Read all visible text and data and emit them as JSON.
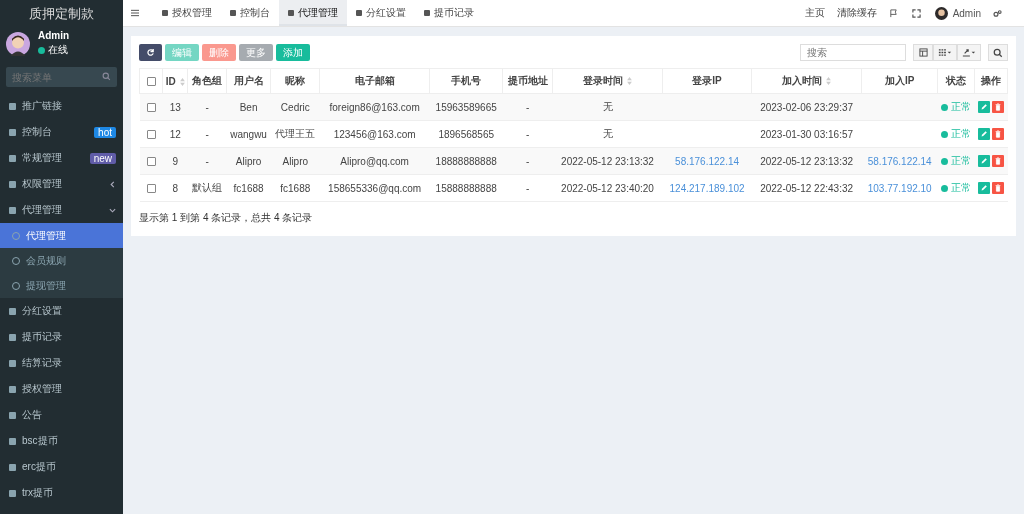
{
  "sidebar": {
    "brand": "质押定制款",
    "user": {
      "name": "Admin",
      "status": "在线"
    },
    "search": {
      "placeholder": "搜索菜单"
    },
    "items": [
      {
        "label": "推广链接",
        "selected": false
      },
      {
        "label": "控制台",
        "selected": false,
        "badge": "hot",
        "color": "#1e88e5"
      },
      {
        "label": "常规管理",
        "selected": false,
        "badge": "new",
        "color": "#605ca8"
      },
      {
        "label": "权限管理",
        "selected": false,
        "expanded": false
      },
      {
        "label": "代理管理",
        "selected": false,
        "expanded": true,
        "children": [
          {
            "label": "代理管理",
            "selected": true
          },
          {
            "label": "会员规则",
            "selected": false
          },
          {
            "label": "提现管理",
            "selected": false
          }
        ]
      },
      {
        "label": "分红设置",
        "selected": false
      },
      {
        "label": "提币记录",
        "selected": false
      },
      {
        "label": "结算记录",
        "selected": false
      },
      {
        "label": "授权管理",
        "selected": false
      },
      {
        "label": "公告",
        "selected": false
      },
      {
        "label": "bsc提币",
        "selected": false
      },
      {
        "label": "erc提币",
        "selected": false
      },
      {
        "label": "trx提币",
        "selected": false
      }
    ]
  },
  "topbar": {
    "tabs": [
      {
        "label": "授权管理",
        "selected": false
      },
      {
        "label": "控制台",
        "selected": false
      },
      {
        "label": "代理管理",
        "selected": true
      },
      {
        "label": "分红设置",
        "selected": false
      },
      {
        "label": "提币记录",
        "selected": false
      }
    ],
    "right": [
      "主页",
      "清除缓存"
    ],
    "user": "Admin"
  },
  "toolbar": {
    "buttons": [
      {
        "label": "编辑",
        "kind": "edit",
        "disabled": true
      },
      {
        "label": "删除",
        "kind": "delete",
        "disabled": true
      },
      {
        "label": "更多",
        "kind": "more",
        "disabled": true
      },
      {
        "label": "添加",
        "kind": "add",
        "disabled": false
      }
    ],
    "search": {
      "placeholder": "搜索"
    }
  },
  "table": {
    "select_all": {
      "checked": false
    },
    "columns": [
      {
        "label": "ID",
        "sortable": true
      },
      {
        "label": "角色组",
        "sortable": false
      },
      {
        "label": "用户名",
        "sortable": false
      },
      {
        "label": "昵称",
        "sortable": false
      },
      {
        "label": "电子邮箱",
        "sortable": false
      },
      {
        "label": "手机号",
        "sortable": false
      },
      {
        "label": "提币地址",
        "sortable": false
      },
      {
        "label": "登录时间",
        "sortable": true
      },
      {
        "label": "登录IP",
        "sortable": false
      },
      {
        "label": "加入时间",
        "sortable": true
      },
      {
        "label": "加入IP",
        "sortable": false
      },
      {
        "label": "状态",
        "sortable": false
      },
      {
        "label": "操作",
        "sortable": false
      }
    ],
    "rows": [
      {
        "checked": false,
        "cells": [
          "13",
          "-",
          "Ben",
          "Cedric",
          "foreign86@163.com",
          "15963589665",
          "-",
          "无",
          "",
          "2023-02-06 23:29:37",
          ""
        ],
        "status": "正常"
      },
      {
        "checked": false,
        "cells": [
          "12",
          "-",
          "wangwu",
          "代理王五",
          "123456@163.com",
          "1896568565",
          "-",
          "无",
          "",
          "2023-01-30 03:16:57",
          ""
        ],
        "status": "正常"
      },
      {
        "checked": false,
        "cells": [
          "9",
          "-",
          "Alipro",
          "Alipro",
          "Alipro@qq.com",
          "18888888888",
          "-",
          "2022-05-12 23:13:32",
          "58.176.122.14",
          "2022-05-12 23:13:32",
          "58.176.122.14"
        ],
        "status": "正常"
      },
      {
        "checked": false,
        "cells": [
          "8",
          "默认组",
          "fc1688",
          "fc1688",
          "158655336@qq.com",
          "15888888888",
          "-",
          "2022-05-12 23:40:20",
          "124.217.189.102",
          "2022-05-12 22:43:32",
          "103.77.192.10"
        ],
        "status": "正常"
      }
    ],
    "footer": "显示第 1 到第 4 条记录，总共 4 条记录"
  }
}
